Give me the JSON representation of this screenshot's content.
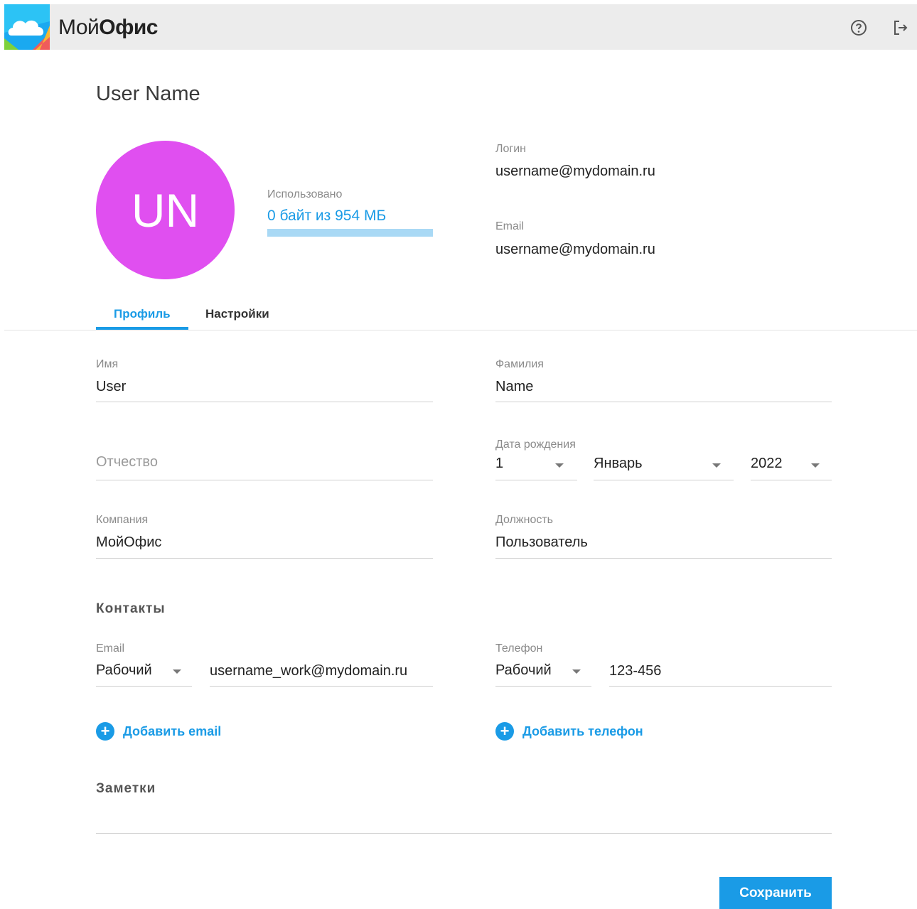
{
  "header": {
    "brand_part1": "Мой",
    "brand_part2": "Офис",
    "icons": [
      "logo-cloud-icon",
      "help-icon",
      "logout-icon"
    ]
  },
  "profile": {
    "display_name": "User Name",
    "initials": "UN",
    "avatar_color": "#e04ff0",
    "storage": {
      "label": "Использовано",
      "value": "0 байт из 954 МБ",
      "used_fraction": 0
    },
    "login_label": "Логин",
    "login_value": "username@mydomain.ru",
    "email_label": "Email",
    "email_value": "username@mydomain.ru"
  },
  "tabs": [
    {
      "label": "Профиль",
      "active": true
    },
    {
      "label": "Настройки",
      "active": false
    }
  ],
  "form": {
    "first_name": {
      "label": "Имя",
      "value": "User"
    },
    "last_name": {
      "label": "Фамилия",
      "value": "Name"
    },
    "middle_name": {
      "placeholder": "Отчество"
    },
    "birthdate": {
      "label": "Дата рождения",
      "day": "1",
      "month": "Январь",
      "year": "2022"
    },
    "company": {
      "label": "Компания",
      "value": "МойОфис"
    },
    "position": {
      "label": "Должность",
      "value": "Пользователь"
    }
  },
  "contacts": {
    "title": "Контакты",
    "email": {
      "label": "Email",
      "type": "Рабочий",
      "value": "username_work@mydomain.ru",
      "add_label": "Добавить email"
    },
    "phone": {
      "label": "Телефон",
      "type": "Рабочий",
      "value": "123-456",
      "add_label": "Добавить телефон"
    }
  },
  "notes": {
    "title": "Заметки",
    "value": ""
  },
  "actions": {
    "save_label": "Сохранить"
  },
  "colors": {
    "accent": "#1a9be6",
    "topbar": "#ececec"
  }
}
